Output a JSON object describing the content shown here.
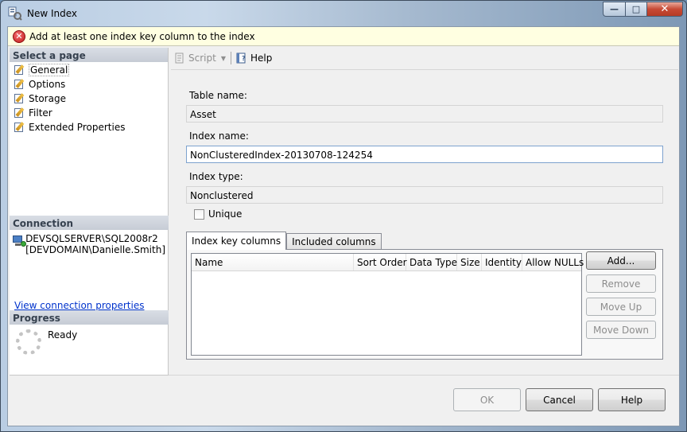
{
  "window": {
    "title": "New Index"
  },
  "banner": {
    "message": "Add at least one index key column to the index"
  },
  "left_pane": {
    "select_page_header": "Select a page",
    "pages": [
      "General",
      "Options",
      "Storage",
      "Filter",
      "Extended Properties"
    ],
    "selected_page": "General",
    "connection_header": "Connection",
    "server": "DEVSQLSERVER\\SQL2008r2",
    "user": "[DEVDOMAIN\\Danielle.Smith]",
    "connection_link": "View connection properties",
    "progress_header": "Progress",
    "progress_status": "Ready"
  },
  "toolbar": {
    "script_label": "Script",
    "help_label": "Help"
  },
  "form": {
    "table_name_label": "Table name:",
    "table_name_value": "Asset",
    "index_name_label": "Index name:",
    "index_name_value": "NonClusteredIndex-20130708-124254",
    "index_type_label": "Index type:",
    "index_type_value": "Nonclustered",
    "unique_label": "Unique",
    "unique_checked": false
  },
  "tabs": [
    "Index key columns",
    "Included columns"
  ],
  "active_tab": "Index key columns",
  "grid": {
    "columns": [
      "Name",
      "Sort Order",
      "Data Type",
      "Size",
      "Identity",
      "Allow NULLs"
    ]
  },
  "side_buttons": {
    "add": "Add...",
    "remove": "Remove",
    "move_up": "Move Up",
    "move_down": "Move Down"
  },
  "dialog_buttons": {
    "ok": "OK",
    "cancel": "Cancel",
    "help": "Help"
  }
}
